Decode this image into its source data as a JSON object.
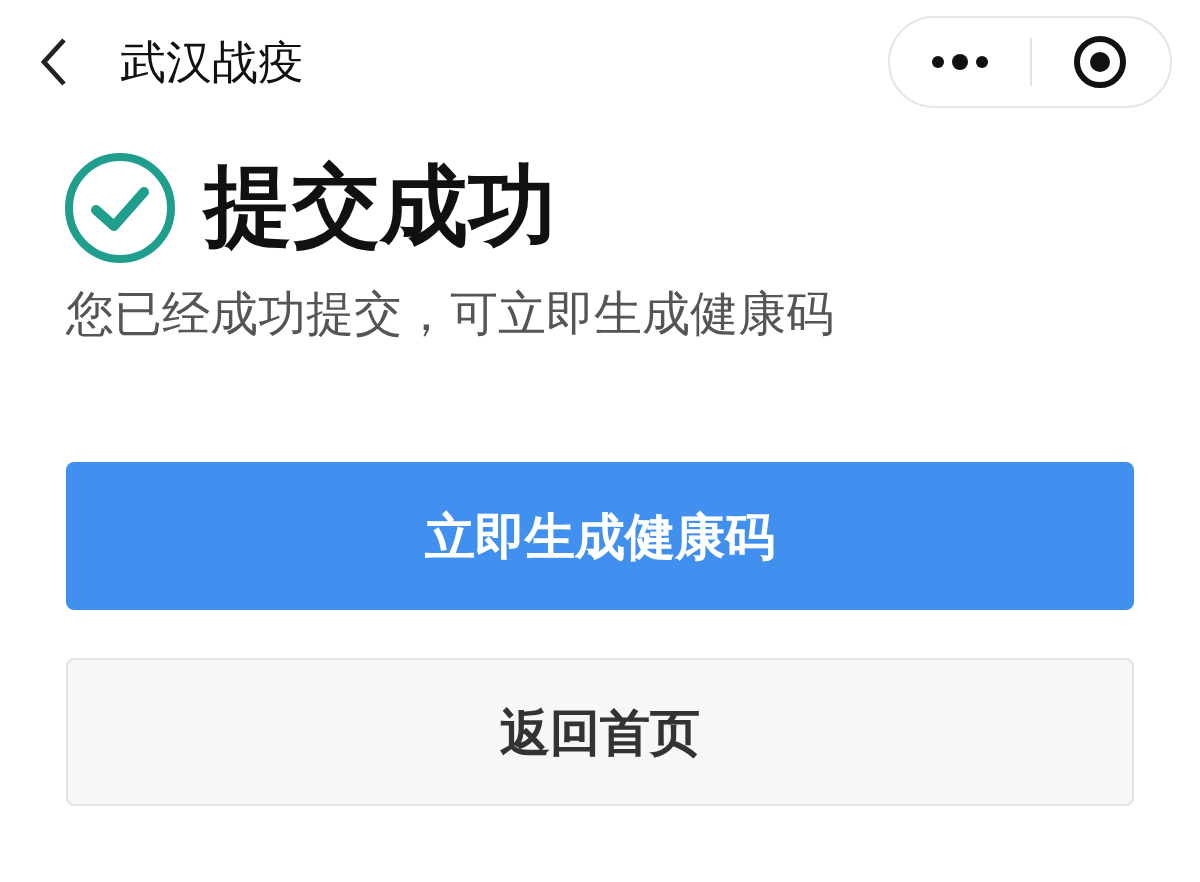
{
  "nav_bar": {
    "title": "武汉战疫"
  },
  "result": {
    "title": "提交成功",
    "message": "您已经成功提交，可立即生成健康码"
  },
  "buttons": [
    {
      "label": "立即生成健康码",
      "kind": "primary"
    },
    {
      "label": "返回首页",
      "kind": "secondary"
    }
  ]
}
